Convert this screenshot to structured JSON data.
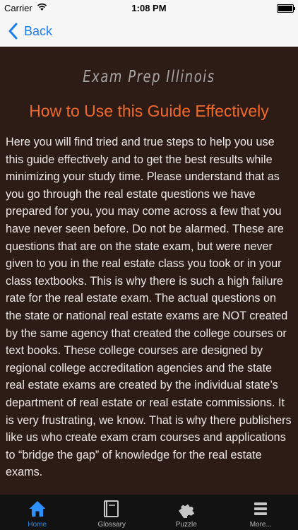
{
  "status_bar": {
    "carrier": "Carrier",
    "time": "1:08 PM"
  },
  "nav": {
    "back_label": "Back"
  },
  "content": {
    "brand": "Exam Prep Illinois",
    "heading": "How to Use this Guide Effectively",
    "body": "Here you will find tried and true steps to help you use this guide effectively and to get the best results while minimizing your study time. Please understand that as you go through the real estate questions we have prepared for you, you may come across a few that you have never seen before. Do not be alarmed. These are questions that are on the state exam, but were never given to you in the real estate class you took or in your class textbooks. This is why there is such a high failure rate for the real estate exam. The actual questions on the state or national real estate exams are NOT created by the same agency that created the college courses or text books. These college courses are designed by regional college accreditation agencies and the state real estate exams are created by the individual state’s department of real estate or real estate commissions. It is very frustrating, we know. That is why there publishers like us who create exam cram courses and applications to “bridge the gap” of knowledge for the real estate exams."
  },
  "tab_bar": {
    "tabs": [
      {
        "label": "Home",
        "icon": "home-icon",
        "active": true
      },
      {
        "label": "Glossary",
        "icon": "book-icon",
        "active": false
      },
      {
        "label": "Puzzle",
        "icon": "puzzle-icon",
        "active": false
      },
      {
        "label": "More...",
        "icon": "menu-icon",
        "active": false
      }
    ]
  },
  "colors": {
    "accent": "#1a7cf5",
    "content_bg": "#2d1b16",
    "heading": "#f06a2c",
    "tab_active": "#2e8fff"
  }
}
